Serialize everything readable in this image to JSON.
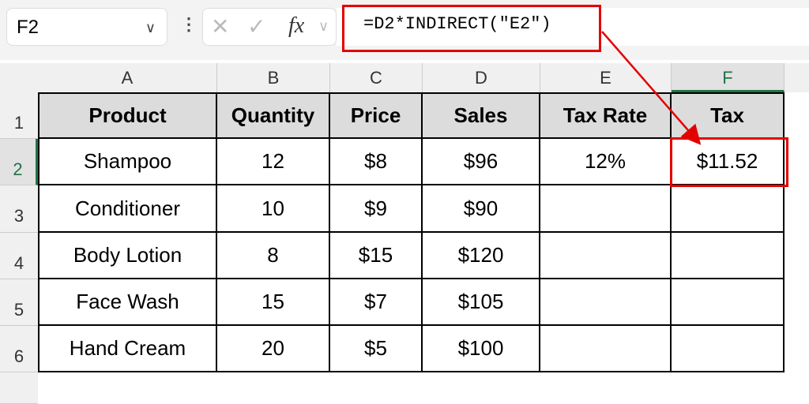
{
  "name_box": "F2",
  "formula": "=D2*INDIRECT(\"E2\")",
  "columns": [
    "A",
    "B",
    "C",
    "D",
    "E",
    "F"
  ],
  "rows": [
    "1",
    "2",
    "3",
    "4",
    "5",
    "6"
  ],
  "table": {
    "headers": [
      "Product",
      "Quantity",
      "Price",
      "Sales",
      "Tax Rate",
      "Tax"
    ],
    "data": [
      [
        "Shampoo",
        "12",
        "$8",
        "$96",
        "12%",
        "$11.52"
      ],
      [
        "Conditioner",
        "10",
        "$9",
        "$90",
        "",
        ""
      ],
      [
        "Body Lotion",
        "8",
        "$15",
        "$120",
        "",
        ""
      ],
      [
        "Face Wash",
        "15",
        "$7",
        "$105",
        "",
        ""
      ],
      [
        "Hand Cream",
        "20",
        "$5",
        "$100",
        "",
        ""
      ]
    ]
  },
  "highlight_color": "#e30000"
}
